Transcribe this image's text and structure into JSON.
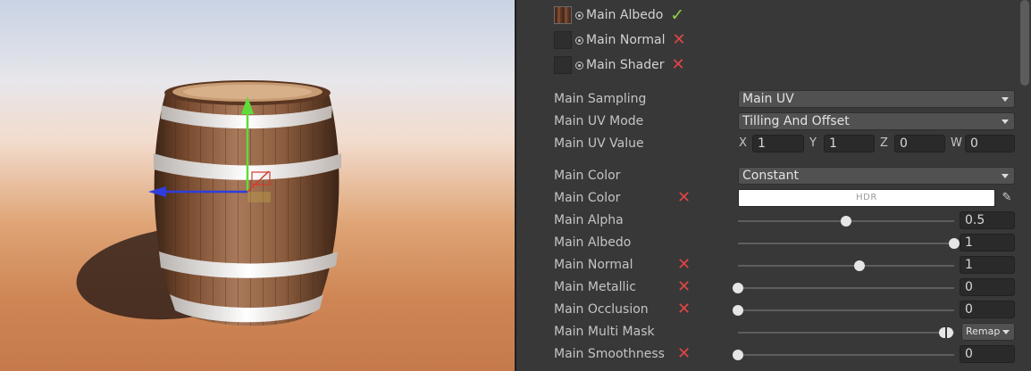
{
  "textures": [
    {
      "label": "Main Albedo",
      "status": "assigned"
    },
    {
      "label": "Main Normal",
      "status": "missing"
    },
    {
      "label": "Main Shader",
      "status": "missing"
    }
  ],
  "main_sampling": {
    "label": "Main Sampling",
    "value": "Main UV"
  },
  "main_uv_mode": {
    "label": "Main UV Mode",
    "value": "Tilling And Offset"
  },
  "main_uv_value": {
    "label": "Main UV Value",
    "x_label": "X",
    "x": "1",
    "y_label": "Y",
    "y": "1",
    "z_label": "Z",
    "z": "0",
    "w_label": "W",
    "w": "0"
  },
  "main_color_mode": {
    "label": "Main Color",
    "value": "Constant"
  },
  "main_color": {
    "label": "Main Color",
    "hdr_label": "HDR",
    "color": "#ffffff"
  },
  "sliders": [
    {
      "key": "alpha",
      "label": "Main Alpha",
      "value": "0.5",
      "fraction": 0.5,
      "x_mark": false
    },
    {
      "key": "albedo",
      "label": "Main Albedo",
      "value": "1",
      "fraction": 1.0,
      "x_mark": false
    },
    {
      "key": "normal",
      "label": "Main Normal",
      "value": "1",
      "fraction": 0.56,
      "x_mark": true
    },
    {
      "key": "metallic",
      "label": "Main Metallic",
      "value": "0",
      "fraction": 0.0,
      "x_mark": true
    },
    {
      "key": "occlusion",
      "label": "Main Occlusion",
      "value": "0",
      "fraction": 0.0,
      "x_mark": true
    }
  ],
  "main_multi_mask": {
    "label": "Main Multi Mask",
    "dropdown": "Remap",
    "fraction": 0.97
  },
  "main_smoothness": {
    "label": "Main Smoothness",
    "value": "0",
    "fraction": 0.0
  },
  "icons": {
    "assigned": "check-icon",
    "missing": "x-icon",
    "picker": "eyedropper-icon"
  },
  "colors": {
    "ok": "#8fd14a",
    "error": "#e04545",
    "panel": "#383838",
    "gizmo_y": "#5fdc3a",
    "gizmo_x": "#2f3dde",
    "gizmo_z": "#d43a2c"
  }
}
